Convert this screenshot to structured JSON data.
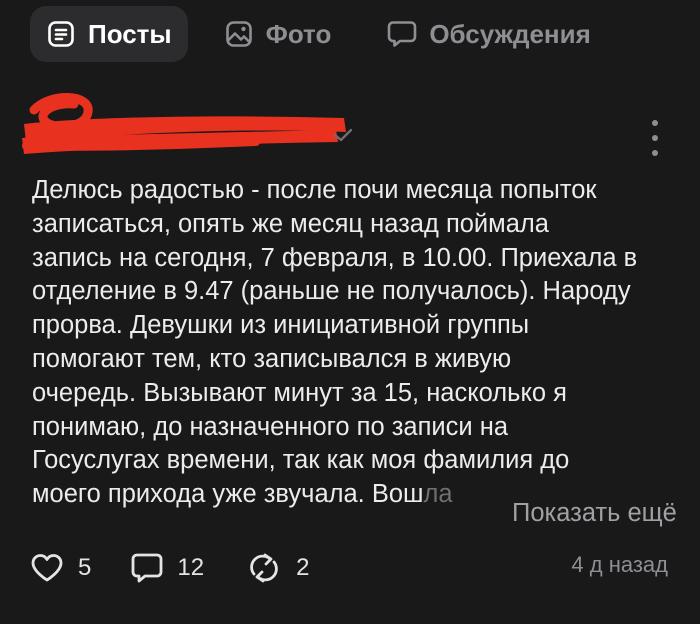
{
  "tabs": [
    {
      "label": "Посты",
      "icon": "posts-icon",
      "active": true
    },
    {
      "label": "Фото",
      "icon": "photo-icon",
      "active": false
    },
    {
      "label": "Обсуждения",
      "icon": "discussion-icon",
      "active": false
    }
  ],
  "post": {
    "lines": [
      "Делюсь радостью - после почи месяца попыток",
      "записаться, опять же месяц назад поймала",
      "запись на сегодня, 7 февраля, в 10.00. Приехала в",
      "отделение в 9.47 (раньше не получалось). Народу",
      "прорва. Девушки из инициативной группы",
      "помогают тем, кто записывался в живую",
      "очередь. Вызывают минут за 15, насколько я",
      "понимаю, до назначенного по записи на",
      "Госуслугах времени, так как моя фамилия до"
    ],
    "last_line_start": "моего прихода уже звучала. Вош",
    "last_line_fade": "ла",
    "show_more_label": "Показать ещё",
    "timestamp": "4 д назад"
  },
  "actions": {
    "likes": "5",
    "comments": "12",
    "reposts": "2"
  },
  "colors": {
    "background": "#19191a",
    "active_tab_bg": "#2c2c2e",
    "censor_red": "#e8321f",
    "muted": "#8e8e93"
  }
}
